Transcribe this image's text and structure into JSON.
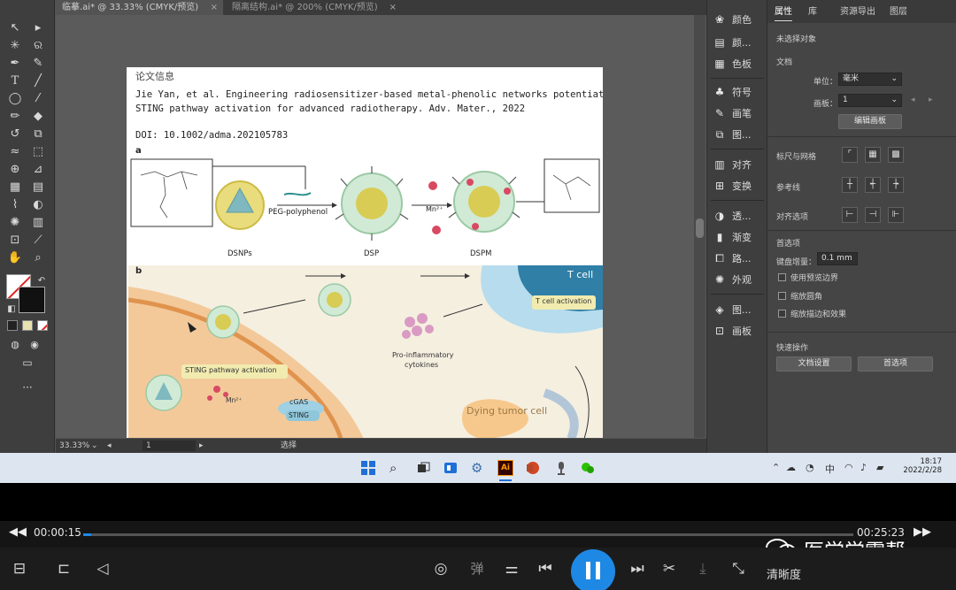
{
  "illustrator": {
    "tabs": [
      {
        "label": "临摹.ai* @ 33.33% (CMYK/预览)",
        "close": "×"
      },
      {
        "label": "隔离结构.ai* @ 200% (CMYK/预览)",
        "close": "×"
      }
    ],
    "tools": [
      "selection-tool",
      "direct-selection-tool",
      "magic-wand-tool",
      "lasso-tool",
      "pen-tool",
      "curvature-tool",
      "type-tool",
      "line-tool",
      "rectangle-tool",
      "paintbrush-tool",
      "pencil-tool",
      "eraser-tool",
      "rotate-tool",
      "scale-tool",
      "width-tool",
      "free-transform-tool",
      "shape-builder-tool",
      "perspective-tool",
      "mesh-tool",
      "gradient-tool",
      "eyedropper-tool",
      "blend-tool",
      "symbol-sprayer-tool",
      "column-graph-tool",
      "artboard-tool",
      "slice-tool",
      "hand-tool",
      "zoom-tool"
    ],
    "more_tools": "···",
    "status": {
      "zoom": "33.33%",
      "artboard": "1",
      "mode": "选择"
    },
    "icon_panel": [
      {
        "icon": "color-icon",
        "label": "颜色"
      },
      {
        "icon": "color-guide-icon",
        "label": "颜..."
      },
      {
        "icon": "swatches-icon",
        "label": "色板"
      },
      {
        "icon": "symbols-icon",
        "label": "符号"
      },
      {
        "icon": "brushes-icon",
        "label": "画笔"
      },
      {
        "icon": "graphic-styles-icon",
        "label": "图..."
      },
      {
        "icon": "align-icon",
        "label": "对齐"
      },
      {
        "icon": "transform-icon",
        "label": "变换"
      },
      {
        "icon": "transparency-icon",
        "label": "透..."
      },
      {
        "icon": "gradient-icon",
        "label": "渐变"
      },
      {
        "icon": "pathfinder-icon",
        "label": "路..."
      },
      {
        "icon": "appearance-icon",
        "label": "外观"
      },
      {
        "icon": "layers-icon",
        "label": "图..."
      },
      {
        "icon": "artboards-icon",
        "label": "画板"
      }
    ],
    "properties": {
      "tabs": [
        "属性",
        "库",
        "资源导出",
        "图层"
      ],
      "no_selection": "未选择对象",
      "document": "文档",
      "units_label": "单位：",
      "units_value": "毫米",
      "artboard_label": "画板：",
      "artboard_value": "1",
      "edit_artboard": "编辑画板",
      "rulers_grids": "标尺与网格",
      "guides": "参考线",
      "snap": "对齐选项",
      "preferences": "首选项",
      "keyboard_increment_label": "键盘增量：",
      "keyboard_increment_value": "0.1 mm",
      "options": [
        "使用预览边界",
        "缩放圆角",
        "缩放描边和效果"
      ],
      "quick_actions": "快速操作",
      "doc_setup": "文档设置",
      "prefs_button": "首选项"
    },
    "paper": {
      "heading": "论文信息",
      "line1": "Jie Yan, et al. Engineering radiosensitizer-based metal-phenolic networks potentiate",
      "line2": "STING pathway activation for advanced radiotherapy. Adv. Mater., 2022",
      "doi": "DOI: 10.1002/adma.202105783"
    },
    "figure": {
      "panel_a": "a",
      "panel_b": "b",
      "peg": "PEG-polyphenol",
      "mn": "Mn²⁺",
      "dsnps": "DSNPs",
      "dsp": "DSP",
      "dspm": "DSPM",
      "t_cell": "T cell",
      "t_cell_activation": "T cell activation",
      "cytokines_1": "Pro-inflammatory",
      "cytokines_2": "cytokines",
      "sting_activation": "STING pathway activation",
      "mn_b": "Mn²⁺",
      "cgas": "cGAS",
      "sting": "STING",
      "dying": "Dying tumor cell"
    }
  },
  "taskbar": {
    "apps": [
      "start-icon",
      "search-icon",
      "task-view-icon",
      "widgets-icon",
      "settings-icon",
      "illustrator-icon",
      "powerpoint-icon",
      "microphone-icon",
      "wechat-icon"
    ],
    "ai_label": "Ai",
    "tray_ime": "中",
    "time": "18:17",
    "date": "2022/2/28"
  },
  "player": {
    "current_time": "00:00:15",
    "total_time": "00:25:23",
    "progress": 0.01,
    "watermark": "医学学霸帮",
    "quality": "清晰度",
    "danmaku": "弹",
    "accent": "#1e88e5"
  }
}
